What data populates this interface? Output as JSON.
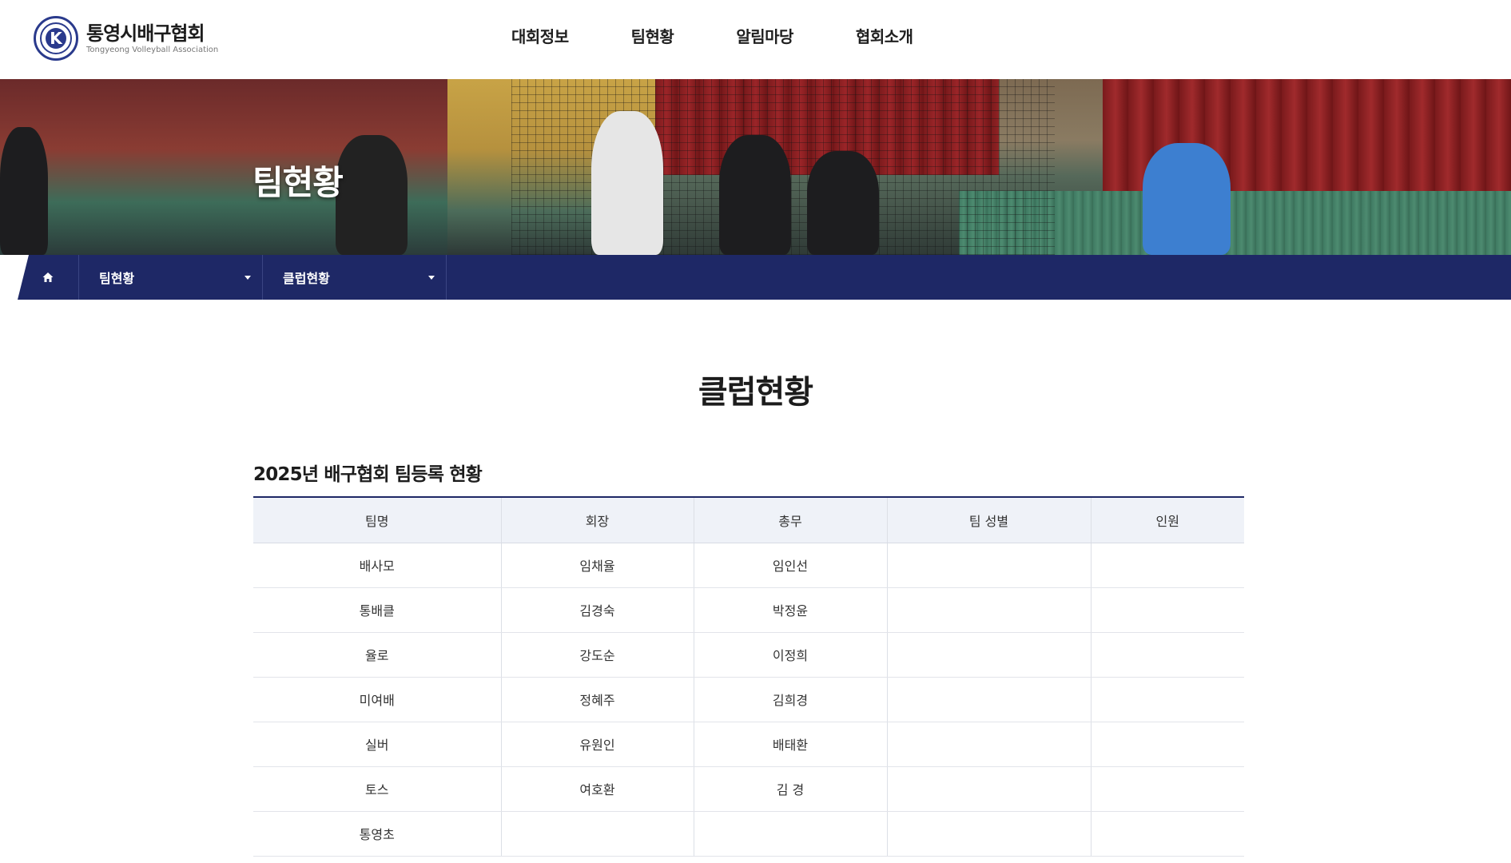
{
  "site": {
    "logo_title": "통영시배구협회",
    "logo_subtitle": "Tongyeong Volleyball Association",
    "logo_emblem_letter": "K"
  },
  "nav": {
    "items": [
      "대회정보",
      "팀현황",
      "알림마당",
      "협회소개"
    ]
  },
  "hero": {
    "title": "팀현황"
  },
  "breadcrumb": {
    "home_icon": "home-icon",
    "level1": "팀현황",
    "level2": "클럽현황"
  },
  "main": {
    "page_title": "클럽현황",
    "section_title": "2025년 배구협회 팀등록 현황",
    "table": {
      "headers": [
        "팀명",
        "회장",
        "총무",
        "팀 성별",
        "인원"
      ],
      "rows": [
        [
          "배사모",
          "임채율",
          "임인선",
          "",
          ""
        ],
        [
          "통배클",
          "김경숙",
          "박정윤",
          "",
          ""
        ],
        [
          "율로",
          "강도순",
          "이정희",
          "",
          ""
        ],
        [
          "미여배",
          "정혜주",
          "김희경",
          "",
          ""
        ],
        [
          "실버",
          "유원인",
          "배태환",
          "",
          ""
        ],
        [
          "토스",
          "여호환",
          "김 경",
          "",
          ""
        ],
        [
          "통영초",
          "",
          "",
          "",
          ""
        ]
      ]
    }
  },
  "colors": {
    "navy": "#1e2866",
    "table_header_bg": "#eff2f8"
  }
}
